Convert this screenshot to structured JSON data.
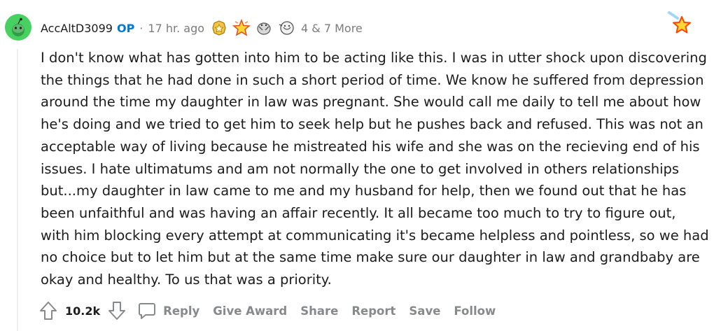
{
  "comment": {
    "username": "AccAltD3099",
    "op_badge": "OP",
    "separator": "·",
    "timestamp": "17 hr. ago",
    "awards": [
      "gold-award-icon",
      "star-award-icon",
      "hug-award-icon",
      "helpful-award-icon"
    ],
    "more_awards": "4 & 7 More",
    "body": "I don't know what has gotten into him to be acting like this. I was in utter shock upon discovering the things that he had done in such a short period of time. We know he suffered from depression around the time my daughter in law was pregnant. She would call me daily to tell me about how he's doing and we tried to get him to seek help but he pushes back and refused. This was not an acceptable way of living because he mistreated his wife and she was on the recieving end of his issues. I hate ultimatums and am not normally the one to get involved in others relationships but...my daughter in law came to me and my husband for help, then we found out that he has been unfaithful and was having an affair recently. It all became too much to try to figure out, with him blocking every attempt at communicating it's became helpless and pointless, so we had no choice but to let him but at the same time make sure our daughter in law and grandbaby are okay and healthy. To us that was a priority."
  },
  "actions": {
    "score": "10.2k",
    "reply": "Reply",
    "give_award": "Give Award",
    "share": "Share",
    "report": "Report",
    "save": "Save",
    "follow": "Follow"
  },
  "colors": {
    "op": "#0079d3",
    "meta": "#7c7c7c",
    "action": "#878a8c",
    "avatar": "#46d160"
  }
}
